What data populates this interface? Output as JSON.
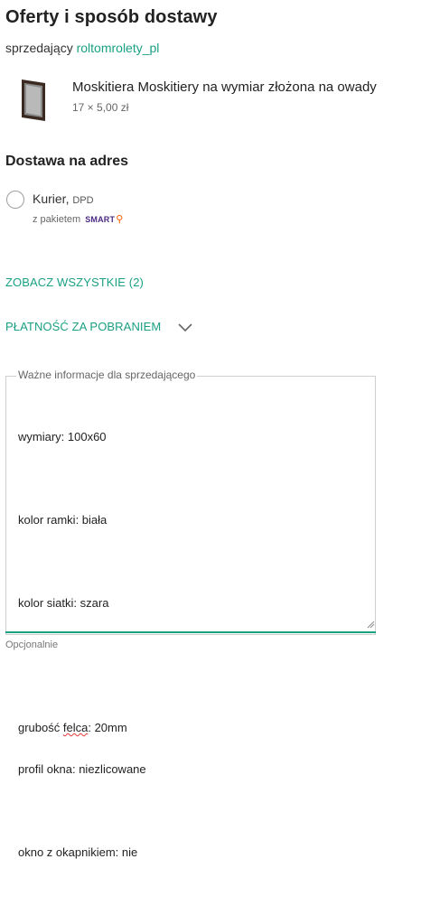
{
  "header": {
    "title": "Oferty i sposób dostawy",
    "seller_prefix": "sprzedający",
    "seller_name": "roltomrolety_pl"
  },
  "product": {
    "name": "Moskitiera Moskitiery na wymiar złożona na owady",
    "price": "17 × 5,00 zł"
  },
  "delivery": {
    "section_title": "Dostawa na adres",
    "option_label": "Kurier,",
    "option_carrier": "DPD",
    "package_label": "z pakietem",
    "smart_label": "SMART"
  },
  "links": {
    "see_all": "ZOBACZ WSZYSTKIE (2)",
    "payment": "PŁATNOŚĆ ZA POBRANIEM"
  },
  "note_field": {
    "legend": "Ważne informacje dla sprzedającego",
    "lines": [
      "wymiary: 100x60",
      "kolor ramki: biała",
      "kolor siatki: szara",
      "grubość ",
      "felca",
      ": 20mm",
      "profil okna: niezlicowane",
      "okno z okapnikiem: nie"
    ],
    "helper": "Opcjonalnie"
  },
  "colors": {
    "accent": "#1aa083",
    "smart_purple": "#4c2a85",
    "smart_orange": "#ff5a00"
  }
}
